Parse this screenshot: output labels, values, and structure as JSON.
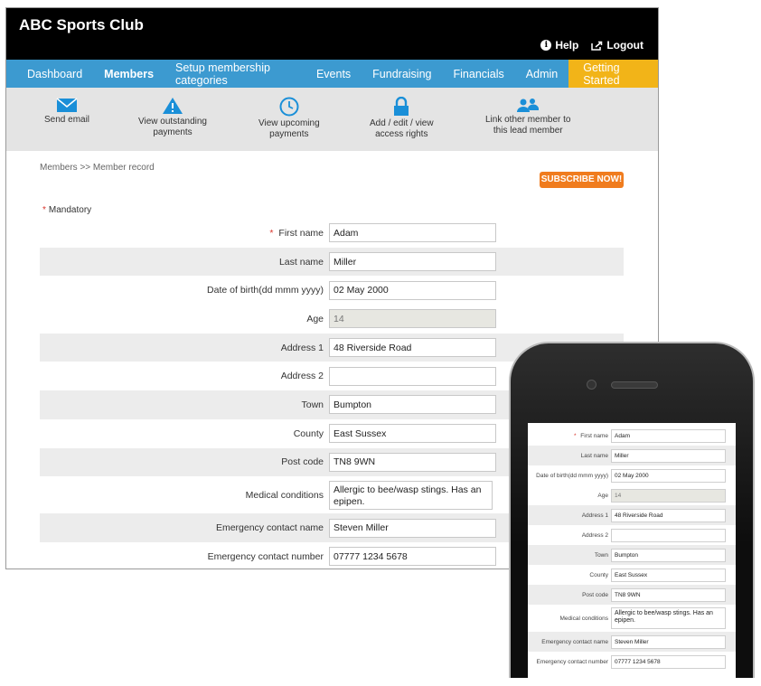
{
  "header": {
    "title": "ABC Sports Club",
    "help_label": "Help",
    "logout_label": "Logout"
  },
  "nav": {
    "items": [
      "Dashboard",
      "Members",
      "Setup membership categories",
      "Events",
      "Fundraising",
      "Financials",
      "Admin"
    ],
    "getting_started": "Getting Started"
  },
  "toolbar": {
    "send_email": "Send email",
    "outstanding_1": "View outstanding",
    "outstanding_2": "payments",
    "upcoming_1": "View upcoming",
    "upcoming_2": "payments",
    "access_1": "Add / edit / view",
    "access_2": "access rights",
    "link_1": "Link other member to",
    "link_2": "this lead member"
  },
  "breadcrumb": "Members >> Member record",
  "subscribe_label": "SUBSCRIBE NOW!",
  "mandatory_label": "Mandatory",
  "form": {
    "first_name": {
      "label": "First name",
      "value": "Adam"
    },
    "last_name": {
      "label": "Last name",
      "value": "Miller"
    },
    "dob": {
      "label": "Date of birth(dd mmm yyyy)",
      "value": "02 May 2000"
    },
    "age": {
      "label": "Age",
      "value": "14"
    },
    "address1": {
      "label": "Address 1",
      "value": "48 Riverside Road"
    },
    "address2": {
      "label": "Address 2",
      "value": ""
    },
    "town": {
      "label": "Town",
      "value": "Bumpton"
    },
    "county": {
      "label": "County",
      "value": "East Sussex"
    },
    "postcode": {
      "label": "Post code",
      "value": "TN8 9WN"
    },
    "medical": {
      "label": "Medical conditions",
      "value": "Allergic to bee/wasp stings.  Has an epipen."
    },
    "emergency_name": {
      "label": "Emergency contact name",
      "value": "Steven Miller"
    },
    "emergency_number": {
      "label": "Emergency contact number",
      "value": "07777 1234 5678"
    }
  },
  "colors": {
    "nav": "#3c9ad0",
    "getting_started": "#f2b418",
    "subscribe": "#f07c1e",
    "toolbar_icon": "#1a8fd8",
    "header": "#000000"
  }
}
